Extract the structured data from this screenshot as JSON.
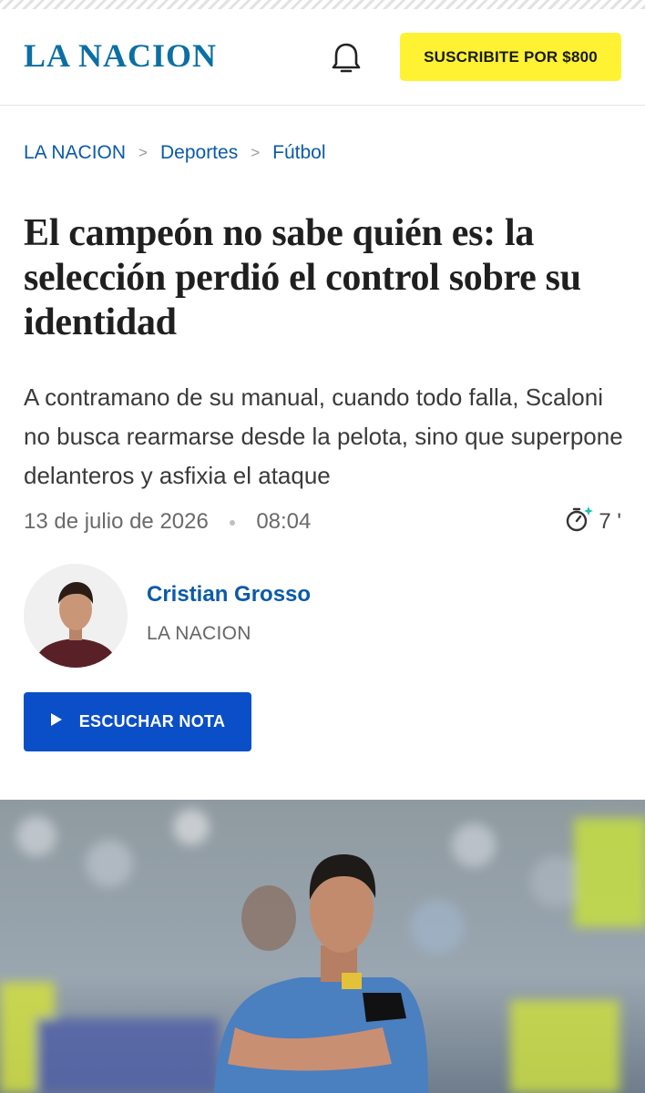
{
  "header": {
    "logo": "LA NACION",
    "notification_icon": "bell-icon",
    "subscribe_label": "SUSCRIBITE POR $800"
  },
  "breadcrumb": [
    "LA NACION",
    "Deportes",
    "Fútbol"
  ],
  "article": {
    "headline": "El campeón no sabe quién es: la selección perdió el control sobre su identidad",
    "summary": "A contramano de su manual, cuando todo falla, Scaloni no busca rearmarse desde la pelota, sino que superpone delanteros y asfixia el ataque",
    "date": "13 de julio de 2026",
    "time": "08:04",
    "reading_time": "7 '",
    "author": {
      "name": "Cristian Grosso",
      "outlet": "LA NACION"
    },
    "listen_label": "ESCUCHAR NOTA"
  },
  "colors": {
    "brand_blue": "#0b6fa4",
    "link_blue": "#0b5aa8",
    "button_blue": "#0a4fc7",
    "subscribe_yellow": "#fff233"
  }
}
